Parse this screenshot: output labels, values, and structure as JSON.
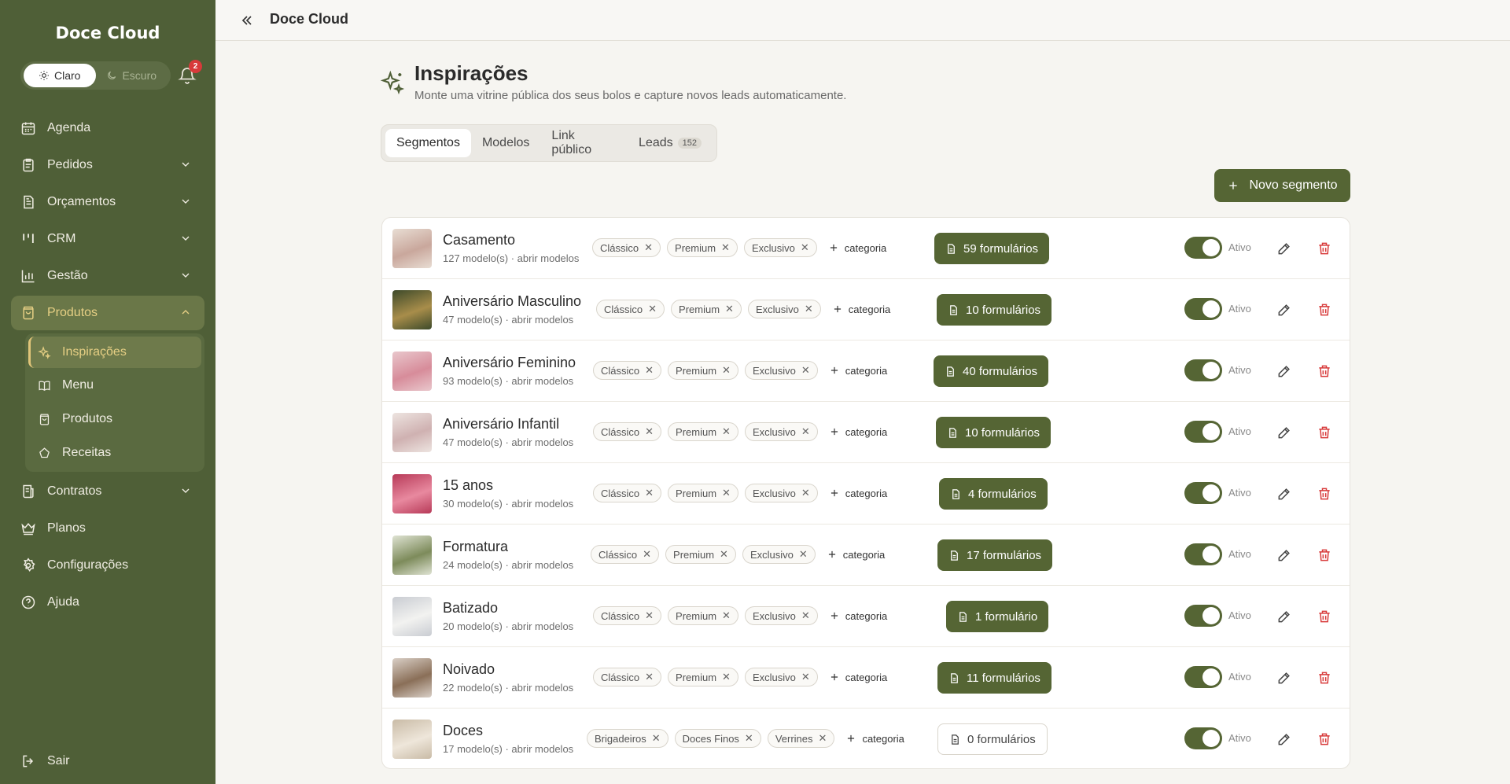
{
  "sidebar": {
    "brand": "Doce Cloud",
    "theme": {
      "light": "Claro",
      "dark": "Escuro"
    },
    "notifications": "2",
    "items": [
      {
        "label": "Agenda",
        "icon": "calendar-icon"
      },
      {
        "label": "Pedidos",
        "icon": "clipboard-icon"
      },
      {
        "label": "Orçamentos",
        "icon": "document-icon"
      },
      {
        "label": "CRM",
        "icon": "kanban-icon"
      },
      {
        "label": "Gestão",
        "icon": "bar-chart-icon"
      },
      {
        "label": "Produtos",
        "icon": "bag-icon"
      },
      {
        "label": "Contratos",
        "icon": "contract-icon"
      },
      {
        "label": "Planos",
        "icon": "crown-icon"
      },
      {
        "label": "Configurações",
        "icon": "gear-icon"
      },
      {
        "label": "Ajuda",
        "icon": "help-icon"
      }
    ],
    "subitems": [
      {
        "label": "Inspirações",
        "icon": "sparkle-icon"
      },
      {
        "label": "Menu",
        "icon": "book-icon"
      },
      {
        "label": "Produtos",
        "icon": "bag-icon"
      },
      {
        "label": "Receitas",
        "icon": "chef-hat-icon"
      }
    ],
    "logout": "Sair"
  },
  "topbar": {
    "title": "Doce Cloud"
  },
  "page": {
    "title": "Inspirações",
    "description": "Monte uma vitrine pública dos seus bolos e capture novos leads automaticamente.",
    "tabs": [
      {
        "label": "Segmentos"
      },
      {
        "label": "Modelos"
      },
      {
        "label": "Link público"
      },
      {
        "label": "Leads",
        "count": "152"
      }
    ],
    "new_button": "Novo segmento",
    "add_category": "categoria",
    "status_label": "Ativo",
    "accent": "#556534",
    "danger": "#d83a3a"
  },
  "segments": [
    {
      "name": "Casamento",
      "sub": "127 modelo(s) · abrir modelos",
      "tags": [
        "Clássico",
        "Premium",
        "Exclusivo"
      ],
      "forms": "59 formulários",
      "active": true
    },
    {
      "name": "Aniversário Masculino",
      "sub": "47 modelo(s) · abrir modelos",
      "tags": [
        "Clássico",
        "Premium",
        "Exclusivo"
      ],
      "forms": "10 formulários",
      "active": true
    },
    {
      "name": "Aniversário Feminino",
      "sub": "93 modelo(s) · abrir modelos",
      "tags": [
        "Clássico",
        "Premium",
        "Exclusivo"
      ],
      "forms": "40 formulários",
      "active": true
    },
    {
      "name": "Aniversário Infantil",
      "sub": "47 modelo(s) · abrir modelos",
      "tags": [
        "Clássico",
        "Premium",
        "Exclusivo"
      ],
      "forms": "10 formulários",
      "active": true
    },
    {
      "name": "15 anos",
      "sub": "30 modelo(s) · abrir modelos",
      "tags": [
        "Clássico",
        "Premium",
        "Exclusivo"
      ],
      "forms": "4 formulários",
      "active": true
    },
    {
      "name": "Formatura",
      "sub": "24 modelo(s) · abrir modelos",
      "tags": [
        "Clássico",
        "Premium",
        "Exclusivo"
      ],
      "forms": "17 formulários",
      "active": true
    },
    {
      "name": "Batizado",
      "sub": "20 modelo(s) · abrir modelos",
      "tags": [
        "Clássico",
        "Premium",
        "Exclusivo"
      ],
      "forms": "1 formulário",
      "active": true
    },
    {
      "name": "Noivado",
      "sub": "22 modelo(s) · abrir modelos",
      "tags": [
        "Clássico",
        "Premium",
        "Exclusivo"
      ],
      "forms": "11 formulários",
      "active": true
    },
    {
      "name": "Doces",
      "sub": "17 modelo(s) · abrir modelos",
      "tags": [
        "Brigadeiros",
        "Doces Finos",
        "Verrines"
      ],
      "forms": "0 formulários",
      "active": true
    }
  ]
}
